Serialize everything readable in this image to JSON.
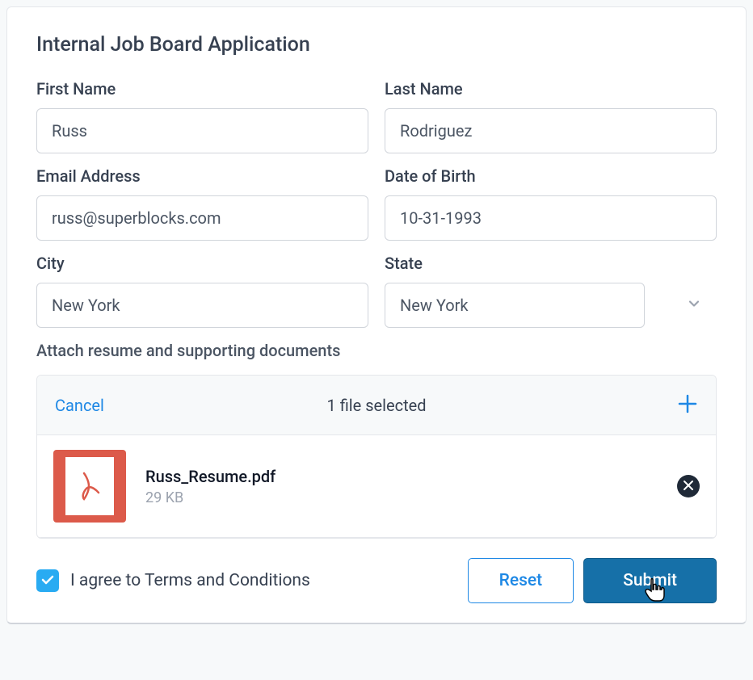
{
  "form": {
    "title": "Internal Job Board Application",
    "firstName": {
      "label": "First Name",
      "value": "Russ"
    },
    "lastName": {
      "label": "Last Name",
      "value": "Rodriguez"
    },
    "email": {
      "label": "Email Address",
      "value": "russ@superblocks.com"
    },
    "dob": {
      "label": "Date of Birth",
      "value": "10-31-1993"
    },
    "city": {
      "label": "City",
      "value": "New York"
    },
    "state": {
      "label": "State",
      "value": "New York"
    },
    "attach": {
      "label": "Attach resume and supporting documents",
      "cancel": "Cancel",
      "countText": "1 file selected",
      "file": {
        "name": "Russ_Resume.pdf",
        "size": "29 KB"
      }
    },
    "terms": {
      "label": "I agree to Terms and Conditions",
      "checked": true
    },
    "buttons": {
      "reset": "Reset",
      "submit": "Submit"
    }
  }
}
